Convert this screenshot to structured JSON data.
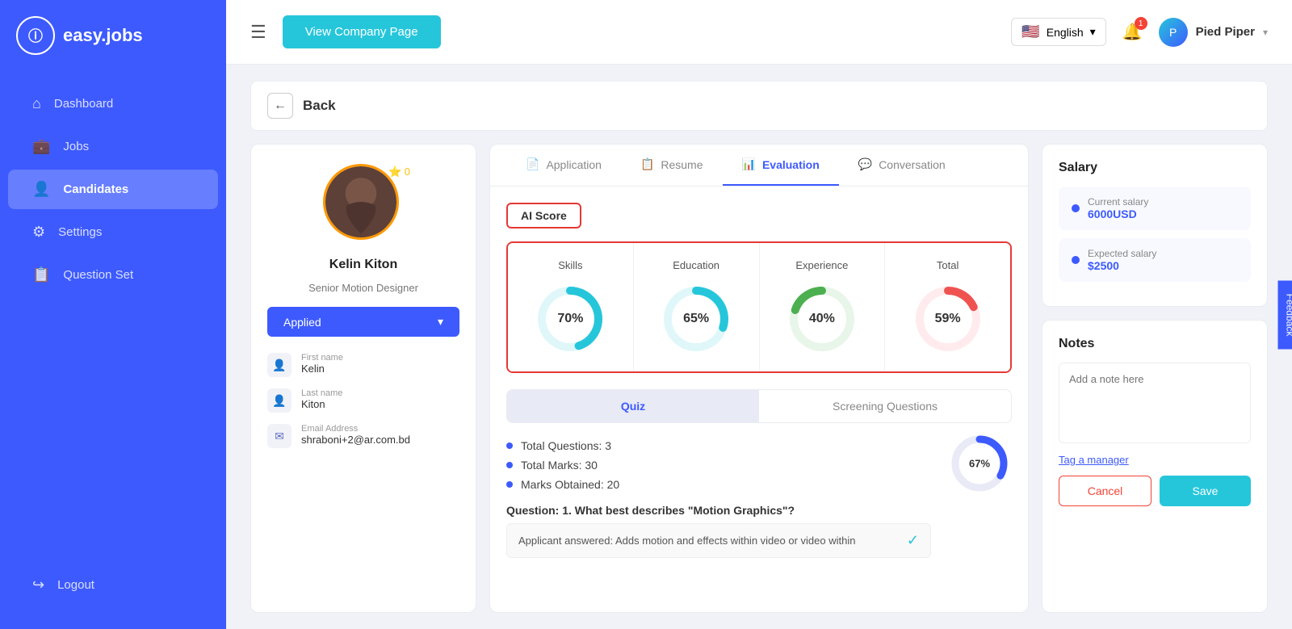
{
  "app": {
    "name": "easy.jobs",
    "logo_letter": "ⓘ"
  },
  "sidebar": {
    "items": [
      {
        "id": "dashboard",
        "label": "Dashboard",
        "icon": "⌂",
        "active": false
      },
      {
        "id": "jobs",
        "label": "Jobs",
        "icon": "💼",
        "active": false
      },
      {
        "id": "candidates",
        "label": "Candidates",
        "icon": "👤",
        "active": true
      },
      {
        "id": "settings",
        "label": "Settings",
        "icon": "⚙",
        "active": false
      },
      {
        "id": "question-set",
        "label": "Question Set",
        "icon": "📋",
        "active": false
      }
    ],
    "logout": {
      "label": "Logout",
      "icon": "↪"
    }
  },
  "header": {
    "menu_icon": "☰",
    "view_company_btn": "View Company Page",
    "language": "English",
    "bell_count": "1",
    "company_name": "Pied Piper",
    "dropdown_arrow": "▾"
  },
  "back": {
    "label": "Back"
  },
  "candidate": {
    "name": "Kelin Kiton",
    "role": "Senior Motion Designer",
    "star_count": "0",
    "status": "Applied",
    "fields": [
      {
        "id": "first-name",
        "label": "First name",
        "value": "Kelin",
        "icon": "👤"
      },
      {
        "id": "last-name",
        "label": "Last name",
        "value": "Kiton",
        "icon": "👤"
      },
      {
        "id": "email",
        "label": "Email Address",
        "value": "shraboni+2@ar.com.bd",
        "icon": "✉"
      }
    ]
  },
  "tabs": [
    {
      "id": "application",
      "label": "Application",
      "icon": "📄",
      "active": false
    },
    {
      "id": "resume",
      "label": "Resume",
      "icon": "📋",
      "active": false
    },
    {
      "id": "evaluation",
      "label": "Evaluation",
      "icon": "📊",
      "active": true
    },
    {
      "id": "conversation",
      "label": "Conversation",
      "icon": "💬",
      "active": false
    }
  ],
  "ai_score": {
    "label": "AI Score",
    "metrics": [
      {
        "id": "skills",
        "label": "Skills",
        "value": 70,
        "color": "#26c6da",
        "text": "70%"
      },
      {
        "id": "education",
        "label": "Education",
        "value": 65,
        "color": "#26c6da",
        "text": "65%"
      },
      {
        "id": "experience",
        "label": "Experience",
        "value": 40,
        "color": "#4caf50",
        "text": "40%"
      },
      {
        "id": "total",
        "label": "Total",
        "value": 59,
        "color": "#ef5350",
        "text": "59%"
      }
    ]
  },
  "sub_tabs": [
    {
      "id": "quiz",
      "label": "Quiz",
      "active": true
    },
    {
      "id": "screening",
      "label": "Screening Questions",
      "active": false
    }
  ],
  "quiz": {
    "stats": [
      {
        "label": "Total Questions: 3"
      },
      {
        "label": "Total Marks: 30"
      },
      {
        "label": "Marks Obtained: 20"
      }
    ],
    "donut_percent": 67,
    "question": "Question: 1. What best describes \"Motion Graphics\"?",
    "answer_preview": "Applicant answered: Adds motion and effects within video or video within",
    "donut_text": "67%"
  },
  "salary": {
    "title": "Salary",
    "current_label": "Current salary",
    "current_amount": "6000USD",
    "expected_label": "Expected salary",
    "expected_amount": "$2500"
  },
  "notes": {
    "title": "Notes",
    "placeholder": "Add a note here",
    "tag_manager": "Tag a manager",
    "cancel_btn": "Cancel",
    "save_btn": "Save"
  },
  "feedback": {
    "label": "Feedback"
  }
}
